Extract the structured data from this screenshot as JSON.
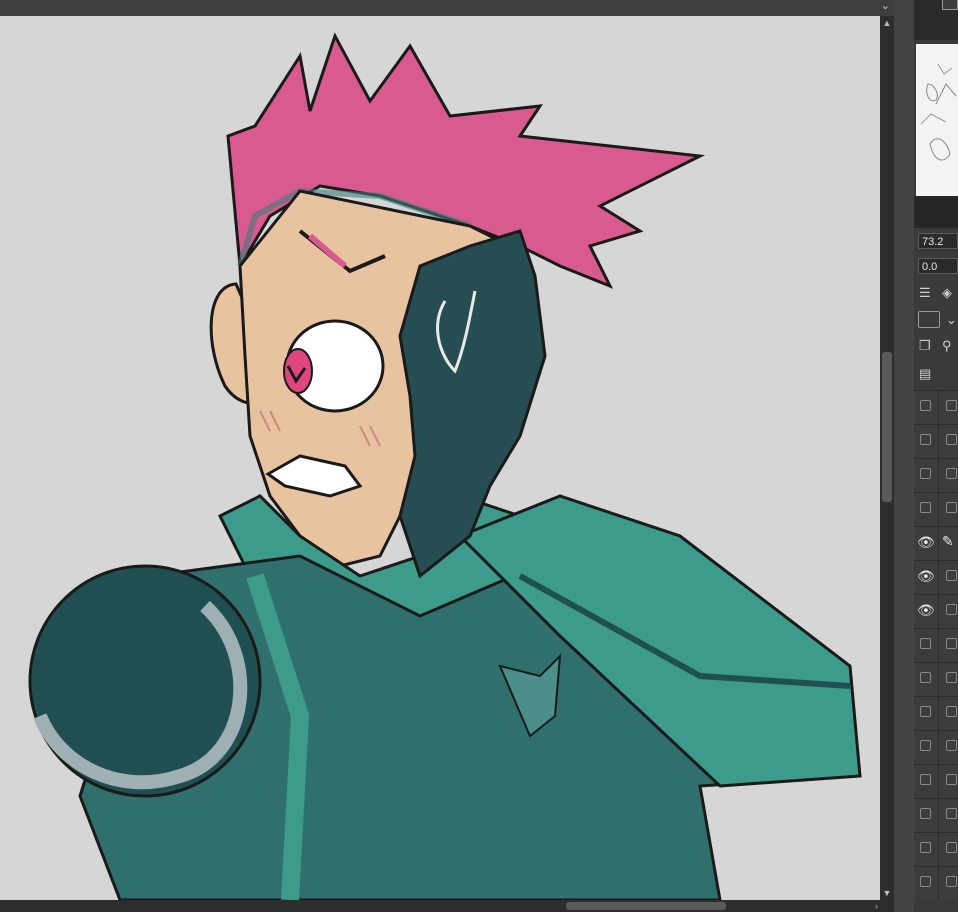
{
  "window": {
    "scroll_chevron": "⌄"
  },
  "canvas": {
    "background": "#d6d6d6",
    "artwork": {
      "hair_color": "#d85a8e",
      "skin_color": "#e8c3a0",
      "suit_color": "#3d9b8c",
      "suit_dark": "#1f4f51",
      "glove_color": "#254d52",
      "eye_color": "#e0457e",
      "line_color": "#1a1a1a"
    }
  },
  "scrollbars": {
    "up_arrow": "▲",
    "down_arrow": "▼",
    "right_arrow": "›"
  },
  "panel": {
    "field_1": "73.2",
    "field_2": "0.0",
    "icons": [
      "menu-icon",
      "layers-icon",
      "shape-icon",
      "chevron-down-icon",
      "copy-icon",
      "lamp-icon",
      "settings-icon"
    ],
    "layers": [
      {
        "visible": false,
        "editing": false
      },
      {
        "visible": false,
        "editing": false
      },
      {
        "visible": false,
        "editing": false
      },
      {
        "visible": false,
        "editing": false
      },
      {
        "visible": true,
        "editing": true
      },
      {
        "visible": true,
        "editing": false
      },
      {
        "visible": true,
        "editing": false
      },
      {
        "visible": false,
        "editing": false
      },
      {
        "visible": false,
        "editing": false
      },
      {
        "visible": false,
        "editing": false
      },
      {
        "visible": false,
        "editing": false
      },
      {
        "visible": false,
        "editing": false
      },
      {
        "visible": false,
        "editing": false
      },
      {
        "visible": false,
        "editing": false
      },
      {
        "visible": false,
        "editing": false
      }
    ]
  }
}
